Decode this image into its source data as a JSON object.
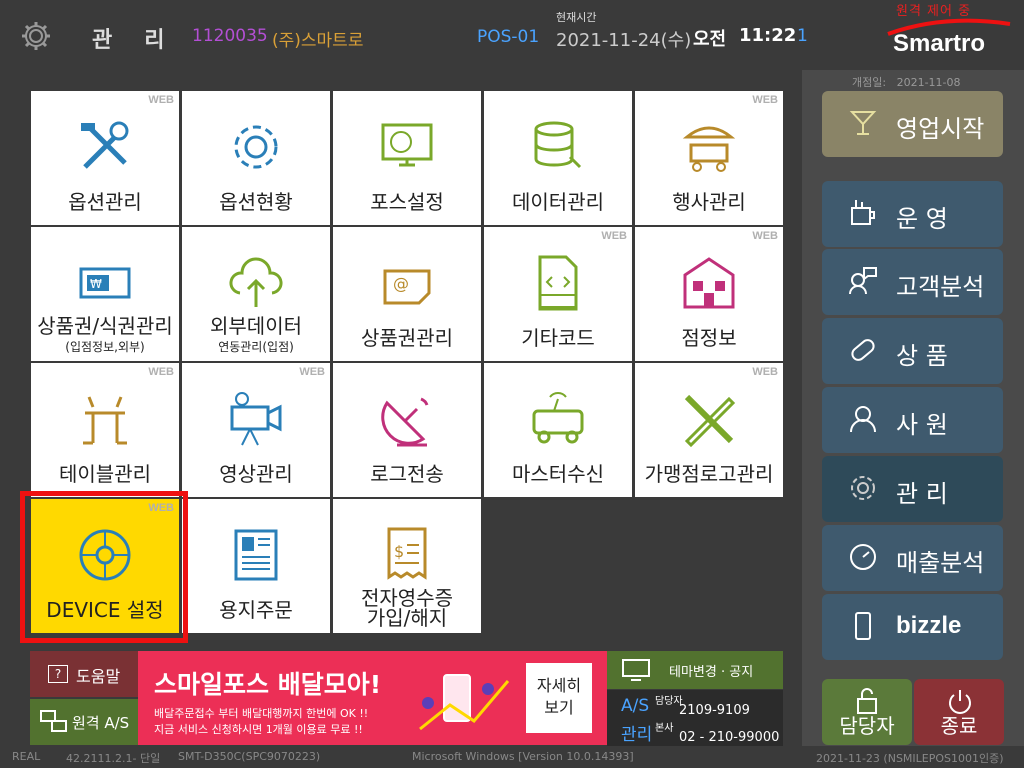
{
  "topbar": {
    "title": "관리",
    "store_code": "1120035",
    "company": "(주)스마트로",
    "pos_id": "POS-01",
    "time_label": "현재시간",
    "date": "2021-11-24(수)",
    "ampm": "오전",
    "time": "11:22",
    "number": "1",
    "remote_status": "원격 제어 중",
    "logo": "Smartro"
  },
  "tiles": [
    {
      "label": "옵션관리",
      "web": "WEB",
      "icon": "tools-icon"
    },
    {
      "label": "옵션현황",
      "web": "",
      "icon": "gear-icon"
    },
    {
      "label": "포스설정",
      "web": "",
      "icon": "monitor-globe-icon"
    },
    {
      "label": "데이터관리",
      "web": "",
      "icon": "database-icon"
    },
    {
      "label": "행사관리",
      "web": "WEB",
      "icon": "market-stall-icon"
    },
    {
      "label": "상품권/식권관리",
      "sub": "(입점정보,외부)",
      "web": "",
      "icon": "voucher-icon"
    },
    {
      "label": "외부데이터",
      "sub": "연동관리(입점)",
      "web": "",
      "icon": "cloud-upload-icon"
    },
    {
      "label": "상품권관리",
      "web": "",
      "icon": "email-card-icon"
    },
    {
      "label": "기타코드",
      "web": "WEB",
      "icon": "code-file-icon"
    },
    {
      "label": "점정보",
      "web": "WEB",
      "icon": "store-icon"
    },
    {
      "label": "테이블관리",
      "web": "WEB",
      "icon": "table-chairs-icon"
    },
    {
      "label": "영상관리",
      "web": "WEB",
      "icon": "video-camera-icon"
    },
    {
      "label": "로그전송",
      "web": "",
      "icon": "satellite-dish-icon"
    },
    {
      "label": "마스터수신",
      "web": "",
      "icon": "broadcast-van-icon"
    },
    {
      "label": "가맹점로고관리",
      "web": "WEB",
      "icon": "pencil-ruler-icon"
    },
    {
      "label": "DEVICE 설정",
      "web": "WEB",
      "icon": "device-wheel-icon"
    },
    {
      "label": "용지주문",
      "web": "",
      "icon": "newspaper-icon"
    },
    {
      "label": "전자영수증",
      "sub2": "가입/해지",
      "web": "",
      "icon": "receipt-icon"
    }
  ],
  "right_panel": {
    "open_date_label": "개점일:",
    "open_date": "2021-11-08",
    "buttons": [
      {
        "label": "영업시작",
        "icon": "cocktail-icon"
      },
      {
        "label": "운  영",
        "icon": "cup-tools-icon"
      },
      {
        "label": "고객분석",
        "icon": "customer-chat-icon"
      },
      {
        "label": "상  품",
        "icon": "product-tag-icon"
      },
      {
        "label": "사  원",
        "icon": "employee-icon"
      },
      {
        "label": "관  리",
        "icon": "gear-icon"
      },
      {
        "label": "매출분석",
        "icon": "gauge-icon"
      },
      {
        "label": "bizzle",
        "icon": "phone-icon"
      }
    ],
    "manager": "담당자",
    "exit": "종료"
  },
  "bottom": {
    "help": "도움말",
    "remote_as": "원격 A/S",
    "ad_title": "스마일포스 배달모아!",
    "ad_line1": "배달주문접수 부터 배달대행까지 한번에 OK !!",
    "ad_line2": "지금 서비스 신청하시면 1개월 이용료 무료 !!",
    "ad_more_1": "자세히",
    "ad_more_2": "보기",
    "theme": "테마변경 · 공지",
    "as_label": "A/S",
    "mgmt_label": "관리",
    "contact_label": "담당자",
    "contact_phone": "2109-9109",
    "hq_label": "본사",
    "hq_phone": "02 - 210-99000"
  },
  "status": {
    "mode": "REAL",
    "version": "42.2111.2.1- 단일",
    "device": "SMT-D350C(SPC9070223)",
    "os": "Microsoft Windows [Version 10.0.14393]",
    "cert": "2021-11-23 (NSMILEPOS1001인증)"
  },
  "colors": {
    "accent_red": "#ec2f56",
    "selected": "#ffd900",
    "nav_blue": "#3f5a6e",
    "store_code": "#b34fd4",
    "company": "#d9a037",
    "pos": "#4aa3ff"
  }
}
